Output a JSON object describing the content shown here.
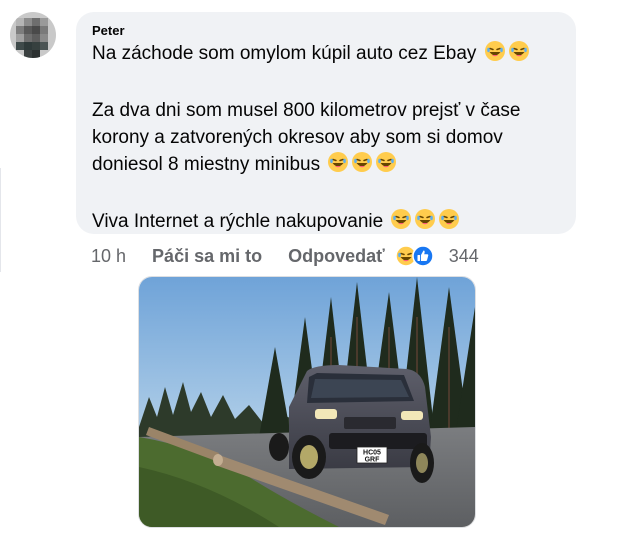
{
  "comment": {
    "author": "Peter",
    "line1": "Na záchode som omylom kúpil auto cez Ebay",
    "line2": "Za dva dni som musel 800 kilometrov prejsť v čase",
    "line3": "korony a zatvorených okresov aby som si domov",
    "line4": "doniesol 8 miestny minibus",
    "line5": "Viva Internet a rýchle nakupovanie"
  },
  "actions": {
    "time": "10 h",
    "like_label": "Páči sa mi to",
    "reply_label": "Odpovedať",
    "reaction_count": "344",
    "reaction_icons": [
      "laughing-reaction-icon",
      "like-reaction-icon"
    ]
  },
  "photo": {
    "plate_line1": "HC05",
    "plate_line2": "GRF"
  },
  "colors": {
    "bubble": "#f0f2f5",
    "muted_text": "#65676b",
    "like_blue": "#1877f2",
    "emoji_yellow": "#ffcc4d"
  }
}
